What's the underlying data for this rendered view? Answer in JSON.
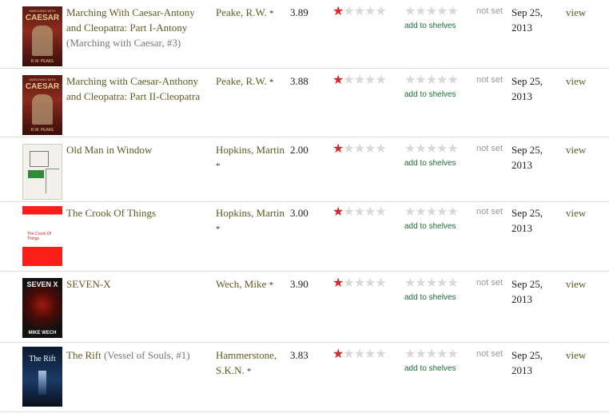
{
  "rows": [
    {
      "title": "Marching With Caesar-Antony and Cleopatra: Part I-Antony",
      "series": "(Marching with Caesar, #3)",
      "author": "Peake, R.W.",
      "author_mark": "*",
      "avg_rating": "3.89",
      "rating_stars": 1,
      "shelves_label": "add to shelves",
      "date_read": "not set",
      "date_added": "Sep 25, 2013",
      "view_label": "view",
      "cover_text_top": "MARCHING WITH",
      "cover_text_main": "CAESAR",
      "cover_text_bottom": "R.W. PEAKE"
    },
    {
      "title": "Marching with Caesar-Anthony and Cleopatra: Part II-Cleopatra",
      "series": "",
      "author": "Peake, R.W.",
      "author_mark": "*",
      "avg_rating": "3.88",
      "rating_stars": 1,
      "shelves_label": "add to shelves",
      "date_read": "not set",
      "date_added": "Sep 25, 2013",
      "view_label": "view",
      "cover_text_top": "MARCHING WITH",
      "cover_text_main": "CAESAR",
      "cover_text_bottom": "R.W. PEAKE"
    },
    {
      "title": "Old Man in Window",
      "series": "",
      "author": "Hopkins, Martin",
      "author_mark": "*",
      "avg_rating": "2.00",
      "rating_stars": 1,
      "shelves_label": "add to shelves",
      "date_read": "not set",
      "date_added": "Sep 25, 2013",
      "view_label": "view"
    },
    {
      "title": "The Crook Of Things",
      "series": "",
      "author": "Hopkins, Martin",
      "author_mark": "*",
      "avg_rating": "3.00",
      "rating_stars": 1,
      "shelves_label": "add to shelves",
      "date_read": "not set",
      "date_added": "Sep 25, 2013",
      "view_label": "view",
      "cover_text_main": "The Crook Of Things"
    },
    {
      "title": "SEVEN-X",
      "series": "",
      "author": "Wech, Mike",
      "author_mark": "*",
      "avg_rating": "3.90",
      "rating_stars": 1,
      "shelves_label": "add to shelves",
      "date_read": "not set",
      "date_added": "Sep 25, 2013",
      "view_label": "view",
      "cover_text_main": "SEVEN X",
      "cover_text_bottom": "MIKE WECH"
    },
    {
      "title": "The Rift",
      "series": "(Vessel of Souls, #1)",
      "author": "Hammerstone, S.K.N.",
      "author_mark": "*",
      "avg_rating": "3.83",
      "rating_stars": 1,
      "shelves_label": "add to shelves",
      "date_read": "not set",
      "date_added": "Sep 25, 2013",
      "view_label": "view",
      "cover_text_main": "The Rift"
    }
  ],
  "icons": {
    "rating": "star-icon",
    "shelf": "empty-star-icon"
  },
  "colors": {
    "link": "#5e5a20",
    "star_on": "#d9262a",
    "star_off": "#d8d8d8",
    "shelves": "#1e6b38"
  }
}
